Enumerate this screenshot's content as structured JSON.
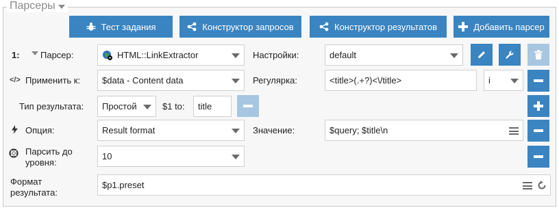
{
  "legend": {
    "title": "Парсеры"
  },
  "toolbar": {
    "test_label": "Тест задания",
    "query_builder_label": "Конструктор запросов",
    "result_builder_label": "Конструктор результатов",
    "add_parser_label": "Добавить парсер"
  },
  "parser_row": {
    "index": "1:",
    "label": "Парсер:",
    "value": "HTML::LinkExtractor",
    "settings_label": "Настройки:",
    "settings_value": "default"
  },
  "apply_row": {
    "label": "Применить к:",
    "value": "$data - Content data",
    "regex_label": "Регулярка:",
    "regex_value": "<title>(.+?)<\\/title>",
    "flags_value": "i"
  },
  "result_type_row": {
    "label": "Тип результата:",
    "value": "Простой",
    "to_label": "$1 to:",
    "to_value": "title"
  },
  "option_row": {
    "label": "Опция:",
    "value": "Result format",
    "value_label": "Значение:",
    "value_value": "$query; $title\\n"
  },
  "depth_row": {
    "label": "Парсить до уровня:",
    "value": "10"
  },
  "format_row": {
    "label": "Формат результата:",
    "value": "$p1.preset"
  }
}
